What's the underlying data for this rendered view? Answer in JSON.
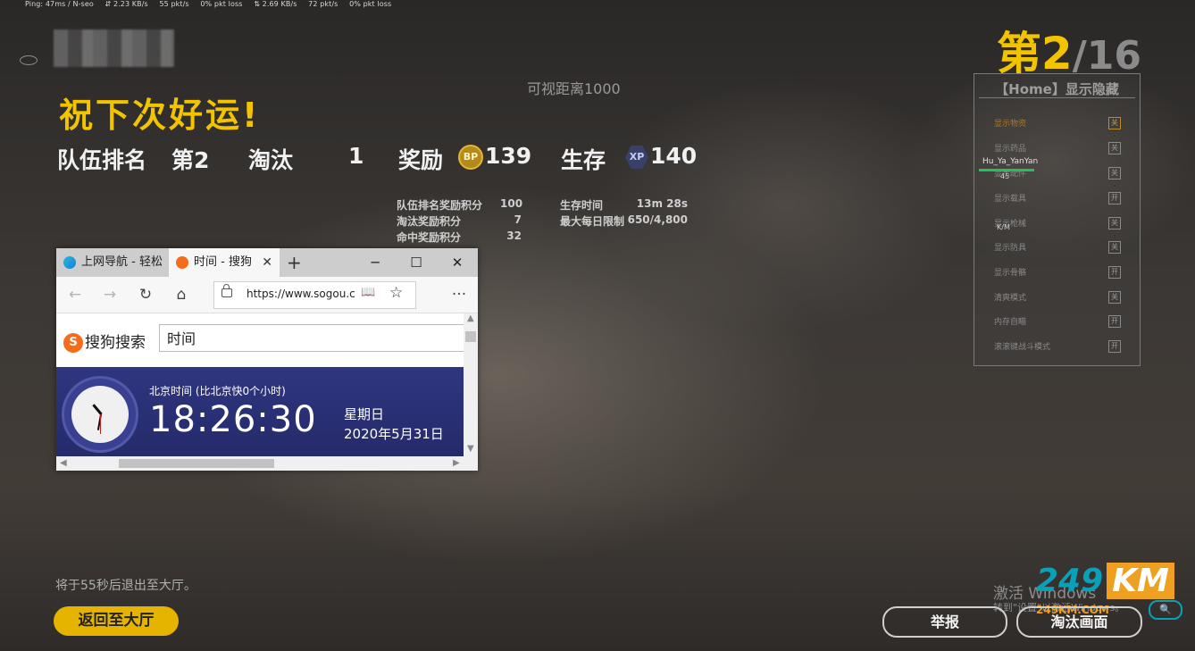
{
  "netstats": {
    "ping": "Ping: 47ms / N-seo",
    "down_rate": "⇵ 2.23 KB/s",
    "down_pkts": "55 pkt/s",
    "down_loss": "0% pkt loss",
    "up_rate": "⇅ 2.69 KB/s",
    "up_pkts": "72 pkt/s",
    "up_loss": "0% pkt loss"
  },
  "result": {
    "title": "祝下次好运!",
    "rank_place": "第2",
    "rank_total": "/16",
    "view_distance": "可视距离1000"
  },
  "stats": {
    "team_rank_label": "队伍排名",
    "team_rank_value": "第2",
    "kills_label": "淘汰",
    "kills_value": "1",
    "reward_label": "奖励",
    "bp_icon": "BP",
    "bp_value": "139",
    "survive_label": "生存",
    "xp_icon": "XP",
    "xp_value": "140"
  },
  "details": {
    "rank_bonus_label": "队伍排名奖励积分",
    "rank_bonus_value": "100",
    "kill_bonus_label": "淘汰奖励积分",
    "kill_bonus_value": "7",
    "hit_bonus_label": "命中奖励积分",
    "hit_bonus_value": "32",
    "survive_time_label": "生存时间",
    "survive_time_value": "13m 28s",
    "daily_limit_label": "最大每日限制",
    "daily_limit_value": "650/4,800"
  },
  "cheat_panel": {
    "title": "【Home】显示隐藏",
    "items": [
      {
        "label": "显示物资",
        "state": "关"
      },
      {
        "label": "显示药品",
        "state": "关"
      },
      {
        "label": "显示配件",
        "state": "关"
      },
      {
        "label": "显示载具",
        "state": "开"
      },
      {
        "label": "显示枪械",
        "state": "关"
      },
      {
        "label": "显示防具",
        "state": "关"
      },
      {
        "label": "显示骨骼",
        "state": "开"
      },
      {
        "label": "清爽模式",
        "state": "关"
      },
      {
        "label": "内存自瞄",
        "state": "开"
      },
      {
        "label": "滚滚键战斗模式",
        "state": "开"
      }
    ]
  },
  "player_tag": {
    "name": "Hu_Ya_YanYan",
    "sub": "45",
    "weapon": "K/M"
  },
  "footer": {
    "exit_notice": "将于55秒后退出至大厅。",
    "back_button": "返回至大厅",
    "report_button": "举报",
    "spectate_button": "淘汰画面",
    "activate_line1": "激活 Windows",
    "activate_line2": "转到\"设置\"以激活Windows。"
  },
  "watermark": {
    "num": "249",
    "km": "KM",
    "domain": "249KM.COM"
  },
  "browser": {
    "tab1_title": "上网导航 - 轻松",
    "tab2_title": "时间 - 搜狗",
    "new_tab": "+",
    "minimize": "─",
    "maximize": "☐",
    "close": "✕",
    "back": "←",
    "forward": "→",
    "refresh": "↻",
    "home": "⌂",
    "url": "https://www.sogou.com",
    "reader": "📖",
    "favorite": "☆",
    "more": "···",
    "search_brand": "搜狗搜索",
    "search_query": "时间",
    "time_zone": "北京时间 (比北京快0个小时)",
    "time": "18:26:30",
    "weekday": "星期日",
    "date": "2020年5月31日"
  },
  "colors": {
    "accent": "#f2c400",
    "bp_gold": "#b48a1a",
    "sogou_orange": "#f56c1a",
    "clock_bg": "#2f3680"
  }
}
